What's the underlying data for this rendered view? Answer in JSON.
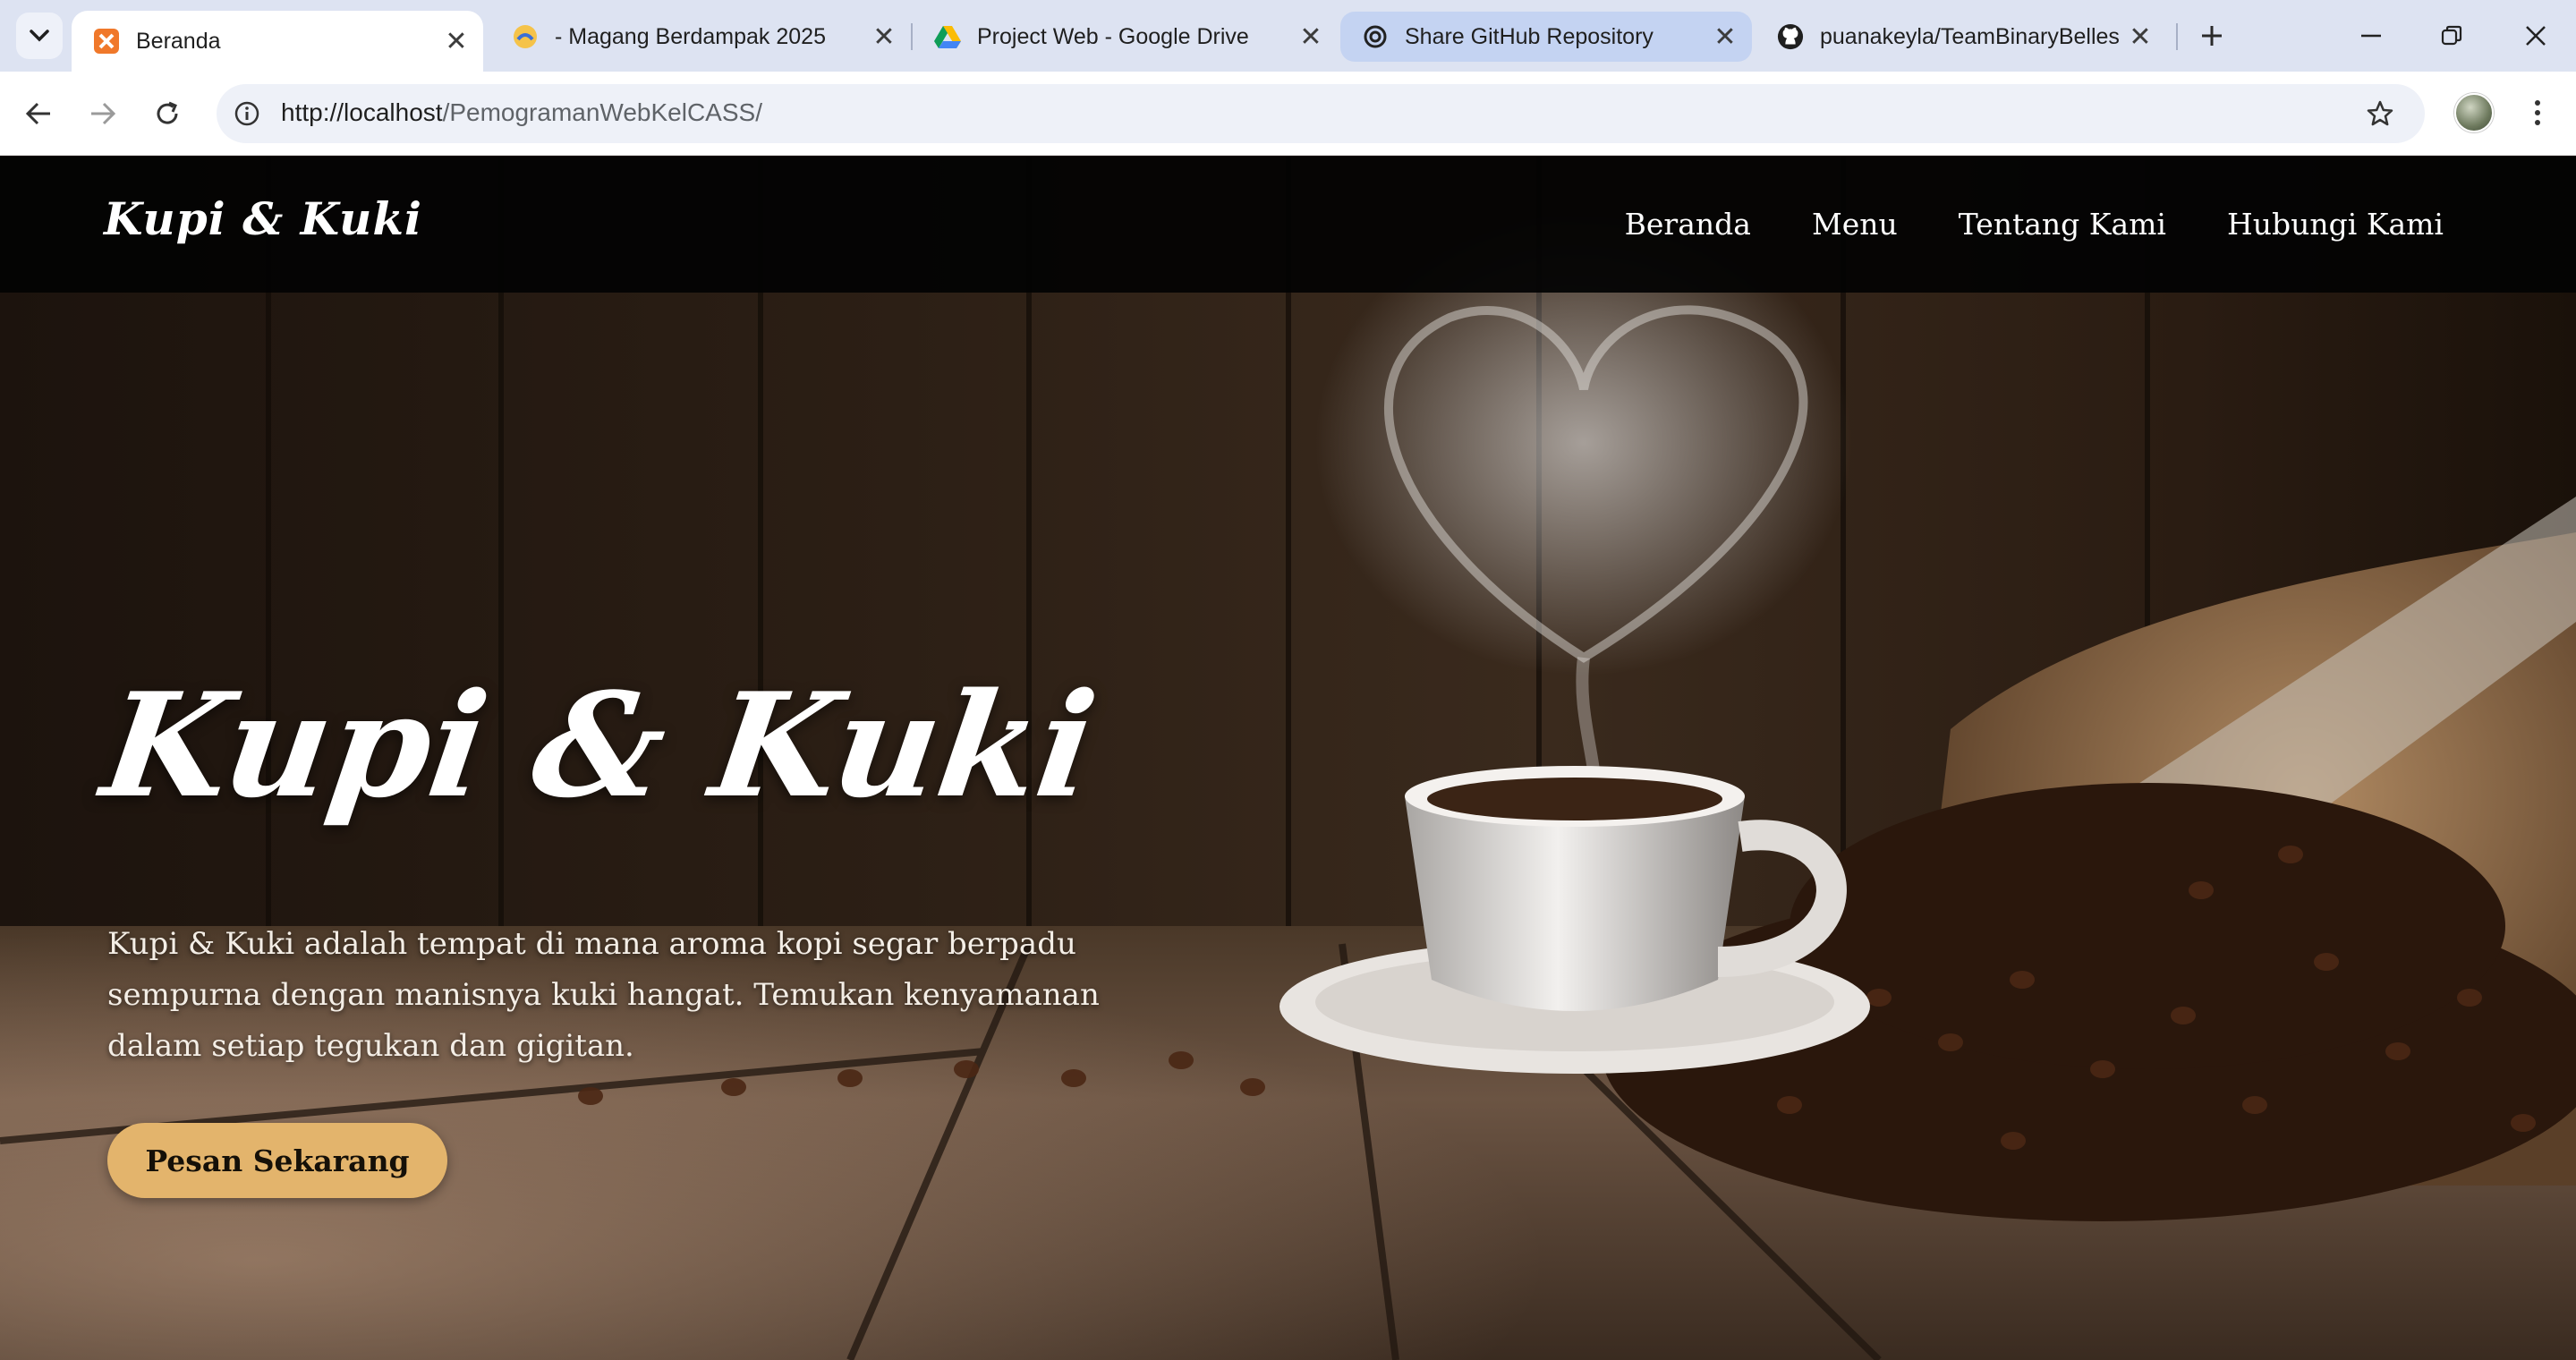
{
  "browser": {
    "tabs": [
      {
        "title": "Beranda",
        "favicon": "xampp-icon",
        "active": true
      },
      {
        "title": "- Magang Berdampak 2025",
        "favicon": "kampus-icon",
        "active": false
      },
      {
        "title": "Project Web - Google Drive",
        "favicon": "google-drive-icon",
        "active": false
      },
      {
        "title": "Share GitHub Repository",
        "favicon": "openai-icon",
        "active": false,
        "highlighted": true
      },
      {
        "title": "puanakeyla/TeamBinaryBelles",
        "favicon": "github-icon",
        "active": false
      }
    ],
    "url_host": "http://localhost",
    "url_path": "/PemogramanWebKelCASS/"
  },
  "site": {
    "logo": "Kupi & Kuki",
    "nav": [
      "Beranda",
      "Menu",
      "Tentang Kami",
      "Hubungi Kami"
    ],
    "hero": {
      "title": "Kupi & Kuki",
      "description": "Kupi & Kuki adalah tempat di mana aroma kopi segar berpadu sempurna dengan manisnya kuki hangat. Temukan kenyamanan dalam setiap tegukan dan gigitan.",
      "cta": "Pesan Sekarang",
      "background": "coffee-cup-with-heart-steam-and-beans-image"
    }
  },
  "colors": {
    "cta_bg": "#e3b46c",
    "header_bg": "#030303",
    "tabbar_bg": "#dde3f2"
  }
}
